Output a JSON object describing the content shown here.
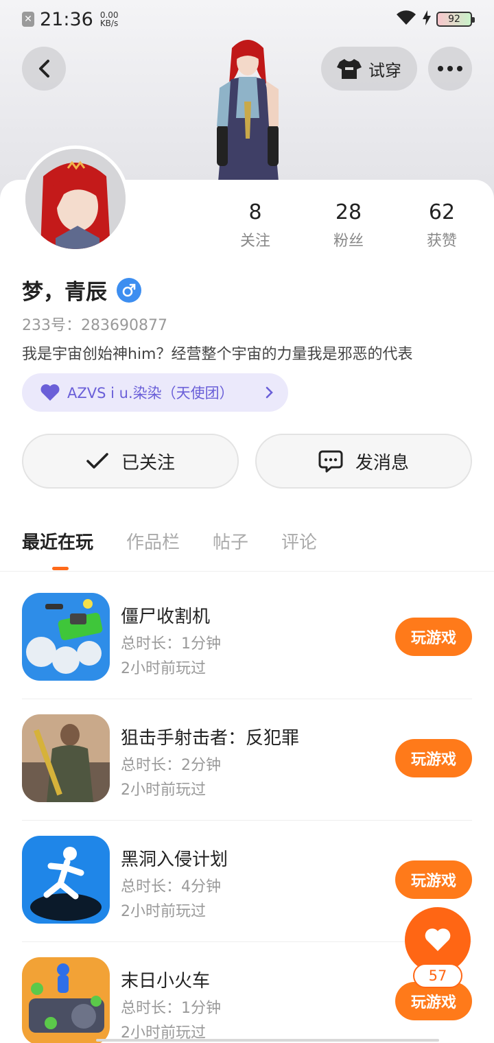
{
  "status_bar": {
    "time": "21:36",
    "net_speed": "0.00",
    "net_unit": "KB/s",
    "battery": "92"
  },
  "header": {
    "try_on_label": "试穿"
  },
  "profile": {
    "stats": [
      {
        "value": "8",
        "label": "关注"
      },
      {
        "value": "28",
        "label": "粉丝"
      },
      {
        "value": "62",
        "label": "获赞"
      }
    ],
    "name": "梦，青辰",
    "uid": "233号：283690877",
    "bio": "我是宇宙创始神him？经营整个宇宙的力量我是邪恶的代表",
    "club": "AZVS i u.染染（天使团）",
    "follow_label": "已关注",
    "message_label": "发消息"
  },
  "tabs": [
    "最近在玩",
    "作品栏",
    "帖子",
    "评论"
  ],
  "games": [
    {
      "title": "僵尸收割机",
      "duration": "总时长：1分钟",
      "last_played": "2小时前玩过",
      "button": "玩游戏"
    },
    {
      "title": "狙击手射击者：反犯罪",
      "duration": "总时长：2分钟",
      "last_played": "2小时前玩过",
      "button": "玩游戏"
    },
    {
      "title": "黑洞入侵计划",
      "duration": "总时长：4分钟",
      "last_played": "2小时前玩过",
      "button": "玩游戏"
    },
    {
      "title": "末日小火车",
      "duration": "总时长：1分钟",
      "last_played": "2小时前玩过",
      "button": "玩游戏"
    }
  ],
  "likes": {
    "count": "57"
  },
  "colors": {
    "accent_orange": "#ff7a1a",
    "club_purple": "#6a5fd8",
    "gender_blue": "#3d8ef0"
  }
}
